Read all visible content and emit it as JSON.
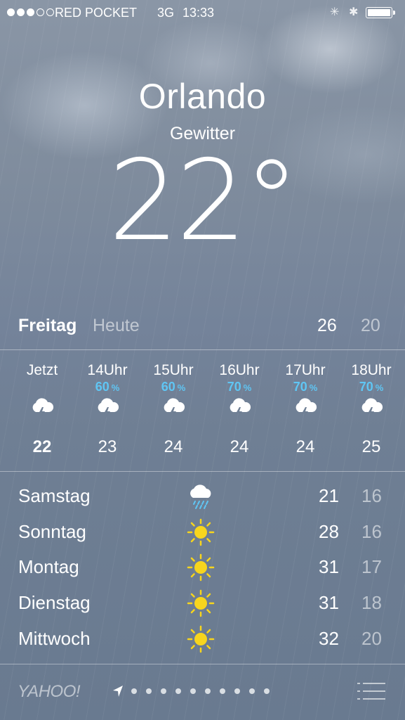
{
  "status_bar": {
    "signal_bars_filled": 3,
    "signal_bars_total": 5,
    "carrier": "RED POCKET",
    "network": "3G",
    "time": "13:33",
    "battery_icon": "battery-full-icon"
  },
  "current": {
    "city": "Orlando",
    "condition": "Gewitter",
    "temperature": "22",
    "degree_symbol": "°"
  },
  "today": {
    "day": "Freitag",
    "label": "Heute",
    "high": "26",
    "low": "20"
  },
  "hourly": [
    {
      "time": "Jetzt",
      "precip": "",
      "unit": "",
      "icon": "thunderstorm-icon",
      "temp": "22"
    },
    {
      "time": "14Uhr",
      "precip": "60",
      "unit": "%",
      "icon": "thunderstorm-icon",
      "temp": "23"
    },
    {
      "time": "15Uhr",
      "precip": "60",
      "unit": "%",
      "icon": "thunderstorm-icon",
      "temp": "24"
    },
    {
      "time": "16Uhr",
      "precip": "70",
      "unit": "%",
      "icon": "thunderstorm-icon",
      "temp": "24"
    },
    {
      "time": "17Uhr",
      "precip": "70",
      "unit": "%",
      "icon": "thunderstorm-icon",
      "temp": "24"
    },
    {
      "time": "18Uhr",
      "precip": "70",
      "unit": "%",
      "icon": "thunderstorm-icon",
      "temp": "25"
    }
  ],
  "daily": [
    {
      "day": "Samstag",
      "icon": "rain-cloud-icon",
      "high": "21",
      "low": "16"
    },
    {
      "day": "Sonntag",
      "icon": "sun-icon",
      "high": "28",
      "low": "16"
    },
    {
      "day": "Montag",
      "icon": "sun-icon",
      "high": "31",
      "low": "17"
    },
    {
      "day": "Dienstag",
      "icon": "sun-icon",
      "high": "31",
      "low": "18"
    },
    {
      "day": "Mittwoch",
      "icon": "sun-icon",
      "high": "32",
      "low": "20"
    }
  ],
  "footer": {
    "brand": "YAHOO!",
    "page_dots": 10
  },
  "colors": {
    "precip_blue": "#5fc6f4",
    "sun_yellow": "#f7d51d"
  }
}
